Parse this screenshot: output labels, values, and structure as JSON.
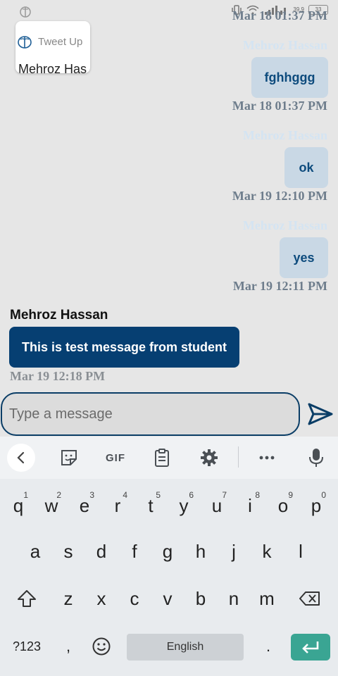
{
  "status_bar": {
    "network_speed": "39.9",
    "battery": "33"
  },
  "app_card": {
    "app_name": "Tweet Up",
    "user_name": "Mehroz Has"
  },
  "messages": [
    {
      "side": "right",
      "sender": "Mehroz Hassan",
      "text": "",
      "timestamp": "Mar 18 01:37 PM"
    },
    {
      "side": "right",
      "sender": "Mehroz Hassan",
      "text": "fghhggg",
      "timestamp": "Mar 18 01:37 PM"
    },
    {
      "side": "right",
      "sender": "Mehroz Hassan",
      "text": "ok",
      "timestamp": "Mar 19 12:10 PM"
    },
    {
      "side": "right",
      "sender": "Mehroz Hassan",
      "text": "yes",
      "timestamp": "Mar 19 12:11 PM"
    },
    {
      "side": "left",
      "sender": "Mehroz Hassan",
      "text": "This is test message from student",
      "timestamp": "Mar 19 12:18 PM"
    }
  ],
  "composer": {
    "placeholder": "Type a message"
  },
  "keyboard": {
    "toolbar": {
      "gif_label": "GIF"
    },
    "row1": [
      {
        "key": "q",
        "hint": "1"
      },
      {
        "key": "w",
        "hint": "2"
      },
      {
        "key": "e",
        "hint": "3"
      },
      {
        "key": "r",
        "hint": "4"
      },
      {
        "key": "t",
        "hint": "5"
      },
      {
        "key": "y",
        "hint": "6"
      },
      {
        "key": "u",
        "hint": "7"
      },
      {
        "key": "i",
        "hint": "8"
      },
      {
        "key": "o",
        "hint": "9"
      },
      {
        "key": "p",
        "hint": "0"
      }
    ],
    "row2": [
      "a",
      "s",
      "d",
      "f",
      "g",
      "h",
      "j",
      "k",
      "l"
    ],
    "row3": [
      "z",
      "x",
      "c",
      "v",
      "b",
      "n",
      "m"
    ],
    "symbols_label": "?123",
    "comma": ",",
    "space_label": "English",
    "period": "."
  },
  "colors": {
    "accent": "#063f72",
    "bubble_right_bg": "#c9d8e5",
    "bubble_right_text": "#0d4b7d",
    "enter_key": "#3aa593",
    "background": "#e6e6e6"
  }
}
